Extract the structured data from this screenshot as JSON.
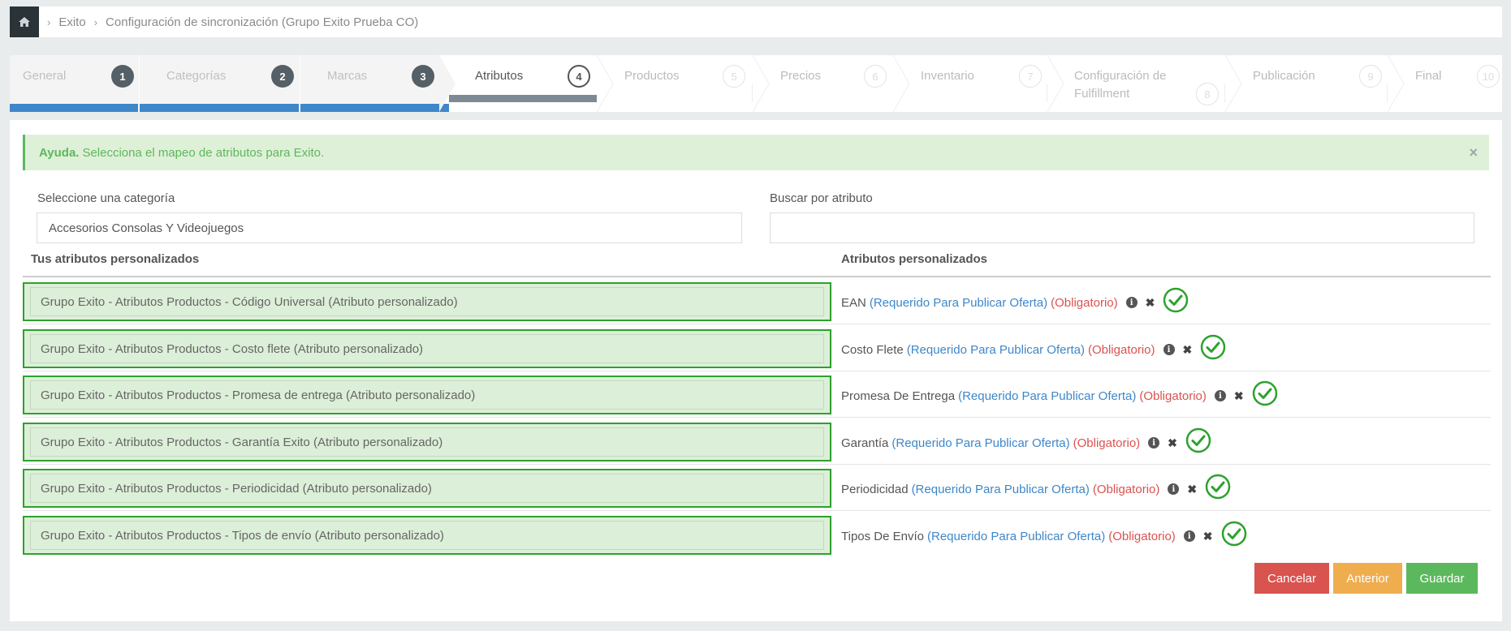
{
  "breadcrumb": {
    "items": [
      "Exito",
      "Configuración de sincronización (Grupo Exito Prueba CO)"
    ]
  },
  "wizard": {
    "steps": [
      {
        "label": "General",
        "num": "1",
        "state": "done"
      },
      {
        "label": "Categorías",
        "num": "2",
        "state": "done"
      },
      {
        "label": "Marcas",
        "num": "3",
        "state": "done"
      },
      {
        "label": "Atributos",
        "num": "4",
        "state": "active"
      },
      {
        "label": "Productos",
        "num": "5",
        "state": "todo"
      },
      {
        "label": "Precios",
        "num": "6",
        "state": "todo"
      },
      {
        "label": "Inventario",
        "num": "7",
        "state": "todo"
      },
      {
        "label": "Configuración de Fulfillment",
        "num": "8",
        "state": "todo"
      },
      {
        "label": "Publicación",
        "num": "9",
        "state": "todo"
      },
      {
        "label": "Final",
        "num": "10",
        "state": "todo"
      }
    ]
  },
  "alert": {
    "title": "Ayuda.",
    "message": "Selecciona el mapeo de atributos para Exito.",
    "close": "×"
  },
  "filters": {
    "category_label": "Seleccione una categoría",
    "category_value": "Accesorios Consolas Y Videojuegos",
    "search_label": "Buscar por atributo",
    "search_value": ""
  },
  "table": {
    "left_header": "Tus atributos personalizados",
    "right_header": "Atributos personalizados",
    "rows": [
      {
        "mapped": "Grupo Exito - Atributos Productos - Código Universal (Atributo personalizado)",
        "attr": "EAN",
        "required": "(Requerido Para Publicar Oferta)",
        "mandatory": "(Obligatorio)"
      },
      {
        "mapped": "Grupo Exito - Atributos Productos - Costo flete (Atributo personalizado)",
        "attr": "Costo Flete",
        "required": "(Requerido Para Publicar Oferta)",
        "mandatory": "(Obligatorio)"
      },
      {
        "mapped": "Grupo Exito - Atributos Productos - Promesa de entrega (Atributo personalizado)",
        "attr": "Promesa De Entrega",
        "required": "(Requerido Para Publicar Oferta)",
        "mandatory": "(Obligatorio)"
      },
      {
        "mapped": "Grupo Exito - Atributos Productos - Garantía Exito (Atributo personalizado)",
        "attr": "Garantía",
        "required": "(Requerido Para Publicar Oferta)",
        "mandatory": "(Obligatorio)"
      },
      {
        "mapped": "Grupo Exito - Atributos Productos - Periodicidad (Atributo personalizado)",
        "attr": "Periodicidad",
        "required": "(Requerido Para Publicar Oferta)",
        "mandatory": "(Obligatorio)"
      },
      {
        "mapped": "Grupo Exito - Atributos Productos - Tipos de envío (Atributo personalizado)",
        "attr": "Tipos De Envío",
        "required": "(Requerido Para Publicar Oferta)",
        "mandatory": "(Obligatorio)"
      }
    ]
  },
  "buttons": {
    "cancel": "Cancelar",
    "previous": "Anterior",
    "save": "Guardar"
  },
  "colors": {
    "primary": "#3e87c9",
    "success": "#5cb85c",
    "danger": "#d9534f",
    "warning": "#f0ad4e",
    "mapped_border": "#2ea12e"
  }
}
